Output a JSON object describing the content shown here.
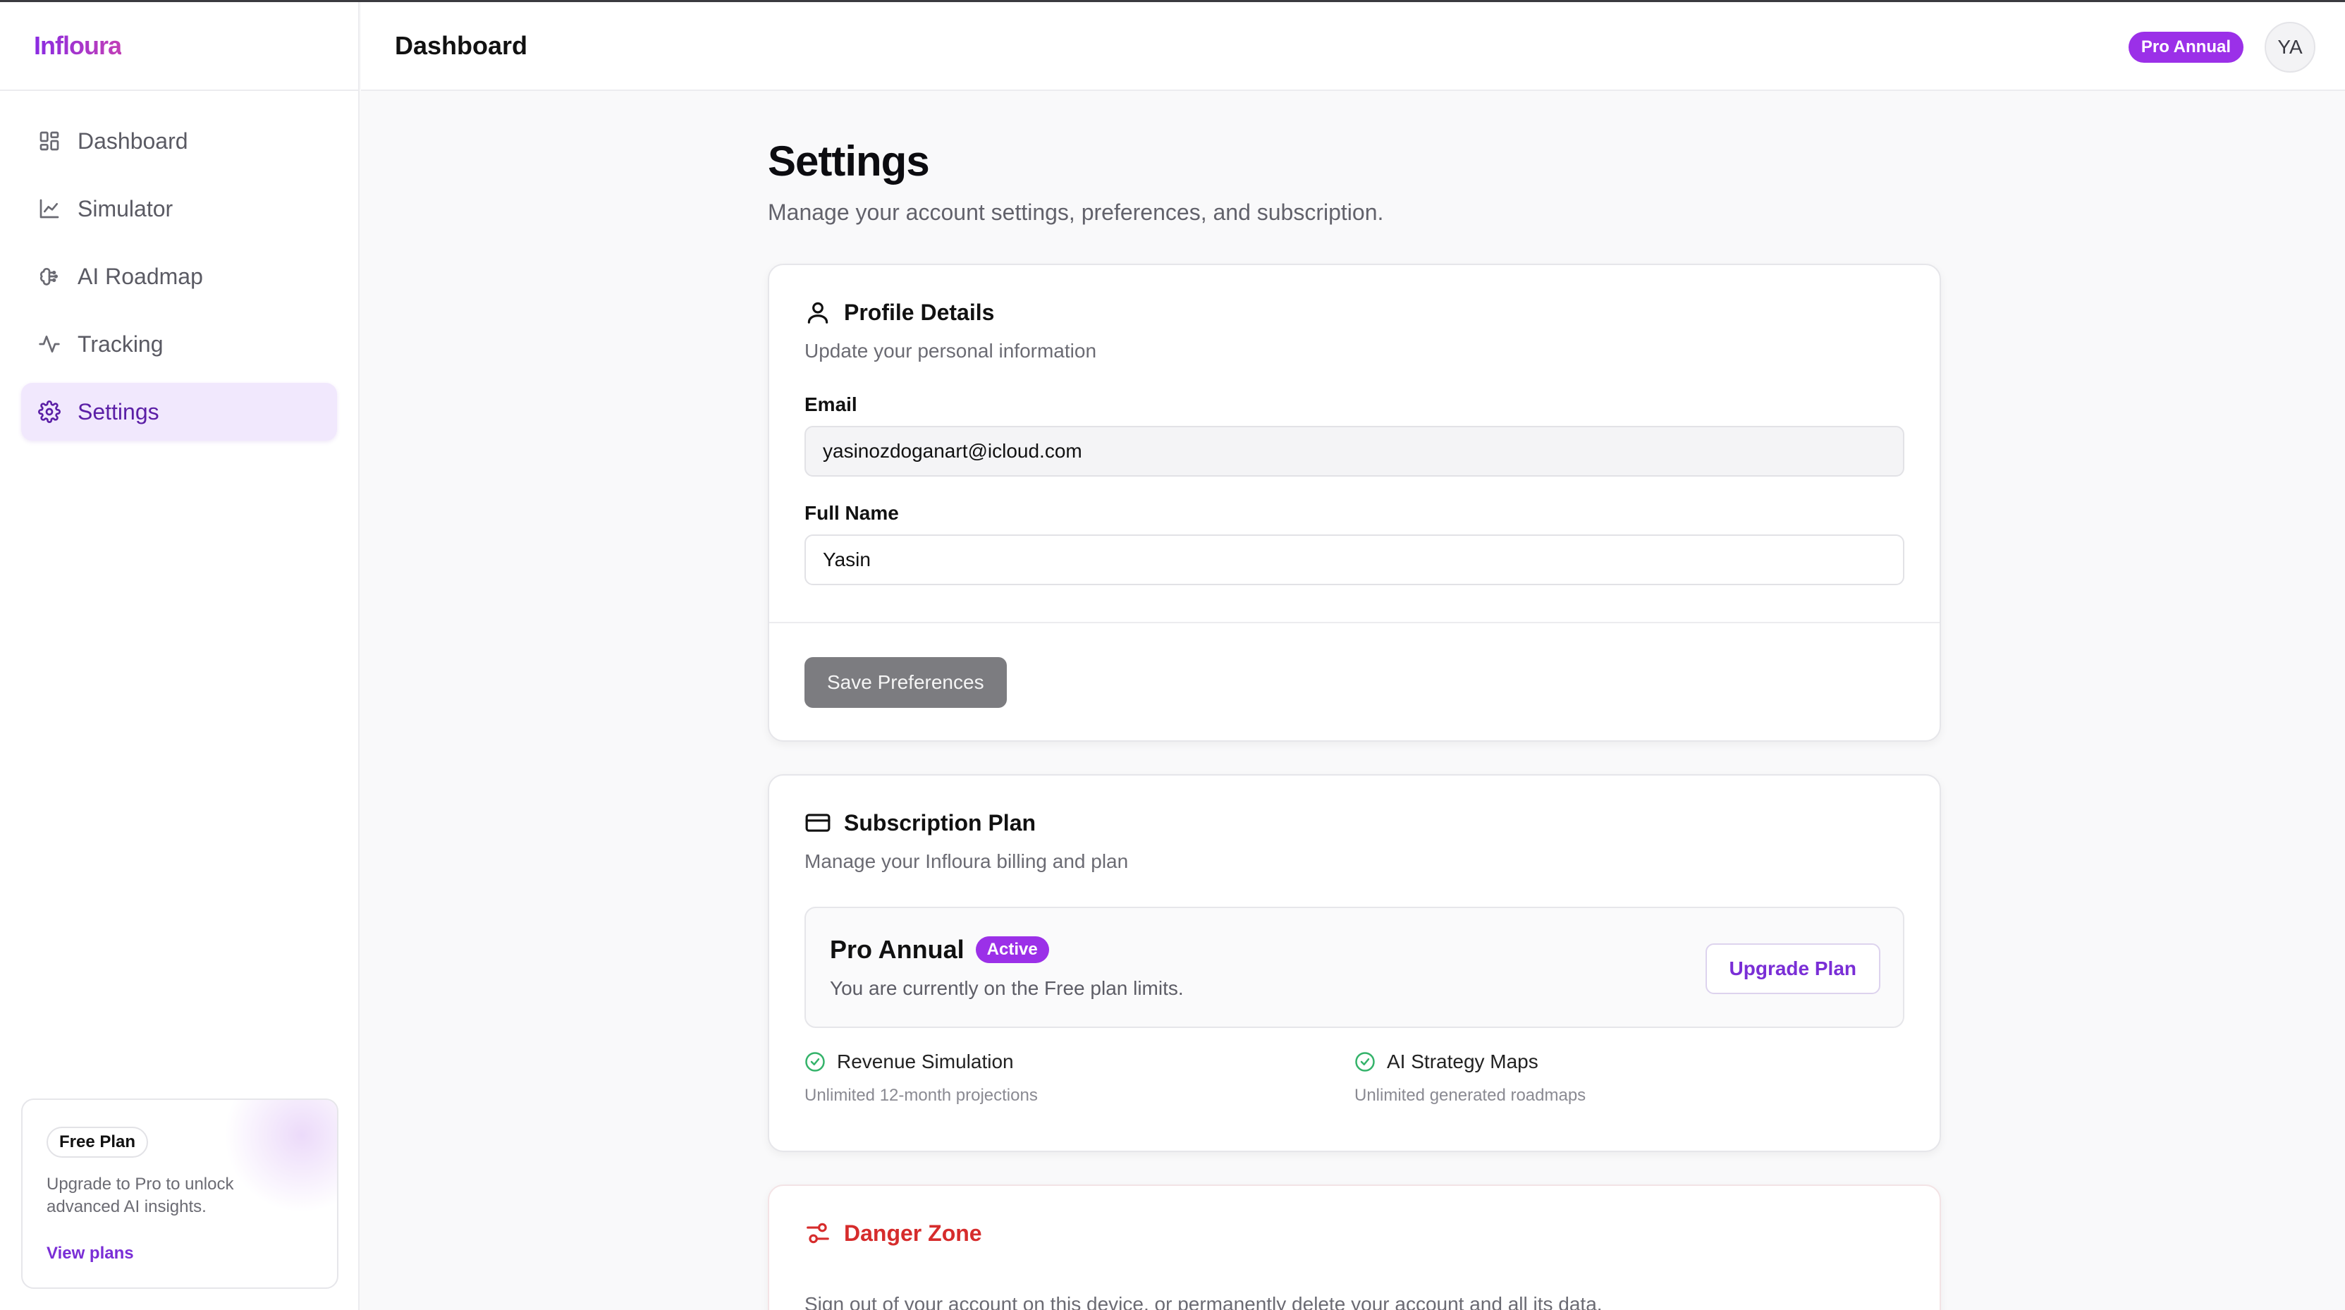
{
  "brand": "Infloura",
  "sidebar": {
    "items": [
      {
        "label": "Dashboard",
        "icon": "grid-icon"
      },
      {
        "label": "Simulator",
        "icon": "line-chart-icon"
      },
      {
        "label": "AI Roadmap",
        "icon": "brain-icon"
      },
      {
        "label": "Tracking",
        "icon": "activity-icon"
      },
      {
        "label": "Settings",
        "icon": "gear-icon",
        "active": true
      }
    ],
    "plan_card": {
      "pill": "Free Plan",
      "description": "Upgrade to Pro to unlock advanced AI insights.",
      "link": "View plans"
    }
  },
  "header": {
    "title": "Dashboard",
    "badge": "Pro Annual",
    "avatar": "YA"
  },
  "page": {
    "title": "Settings",
    "subtitle": "Manage your account settings, preferences, and subscription."
  },
  "profile": {
    "title": "Profile Details",
    "subtitle": "Update your personal information",
    "email_label": "Email",
    "email_value": "yasinozdoganart@icloud.com",
    "name_label": "Full Name",
    "name_value": "Yasin",
    "save_label": "Save Preferences"
  },
  "subscription": {
    "title": "Subscription Plan",
    "subtitle": "Manage your Infloura billing and plan",
    "plan_name": "Pro Annual",
    "status": "Active",
    "note": "You are currently on the Free plan limits.",
    "upgrade_label": "Upgrade Plan",
    "features": [
      {
        "title": "Revenue Simulation",
        "desc": "Unlimited 12-month projections"
      },
      {
        "title": "AI Strategy Maps",
        "desc": "Unlimited generated roadmaps"
      }
    ]
  },
  "danger": {
    "title": "Danger Zone",
    "text": "Sign out of your account on this device, or permanently delete your account and all its data."
  },
  "colors": {
    "accent": "#9b30e8",
    "active_nav_bg": "#f1e8fd",
    "danger": "#d62c2c",
    "success": "#34b36a"
  }
}
